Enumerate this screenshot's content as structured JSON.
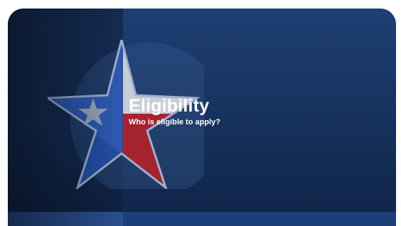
{
  "card": {
    "title": "Eligibility",
    "subtitle": "Who is eligible to apply?",
    "art_icon": "texas-star-icon"
  },
  "colors": {
    "background_top": "#1e3f74",
    "background_bottom": "#0f2447",
    "star_blue": "#2450a8",
    "star_red": "#a5232f",
    "star_white": "#c9ced6",
    "text": "#ffffff"
  }
}
